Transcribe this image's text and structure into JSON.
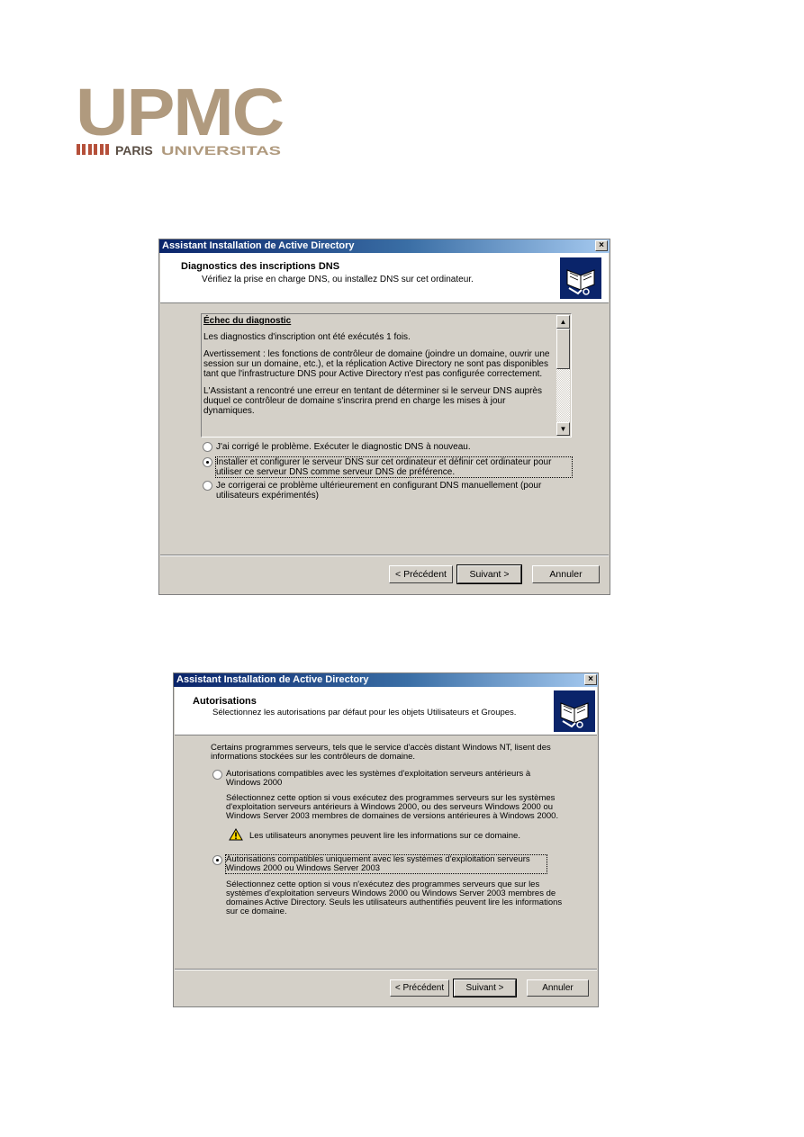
{
  "logo": {
    "text": "UPMC",
    "tagline_1": "PARIS",
    "tagline_2": "UNIVERSITAS"
  },
  "dialog1": {
    "title": "Assistant Installation de Active Directory",
    "close": "×",
    "header_title": "Diagnostics des inscriptions DNS",
    "header_subtitle": "Vérifiez la prise en charge DNS, ou installez DNS sur cet ordinateur.",
    "header_icon": "directory-book-icon",
    "diagnostic": {
      "heading": "Échec du diagnostic",
      "p1": "Les diagnostics d'inscription ont été exécutés 1 fois.",
      "p2": "Avertissement : les fonctions de contrôleur de domaine (joindre un domaine, ouvrir une session sur un domaine, etc.), et la réplication Active Directory ne sont pas disponibles tant que l'infrastructure DNS pour Active Directory n'est pas configurée correctement.",
      "p3": "L'Assistant a rencontré une erreur en tentant de déterminer si le serveur DNS auprès duquel ce contrôleur de domaine s'inscrira prend en charge les mises à jour dynamiques."
    },
    "options": [
      {
        "label": "J'ai corrigé le problème. Exécuter le diagnostic DNS à nouveau.",
        "selected": false
      },
      {
        "label": "Installer et configurer le serveur DNS sur cet ordinateur et définir cet ordinateur pour utiliser ce serveur DNS comme serveur DNS de préférence.",
        "selected": true
      },
      {
        "label": "Je corrigerai ce problème ultérieurement en configurant DNS manuellement (pour utilisateurs expérimentés)",
        "selected": false
      }
    ],
    "buttons": {
      "back": "< Précédent",
      "next": "Suivant >",
      "cancel": "Annuler"
    }
  },
  "dialog2": {
    "title": "Assistant Installation de Active Directory",
    "close": "×",
    "header_title": "Autorisations",
    "header_subtitle": "Sélectionnez les autorisations par défaut pour les objets Utilisateurs et Groupes.",
    "header_icon": "directory-book-icon",
    "intro": "Certains programmes serveurs, tels que le service d'accès distant Windows NT, lisent des informations stockées sur les contrôleurs de domaine.",
    "option1_label": "Autorisations compatibles avec les systèmes d'exploitation serveurs antérieurs à Windows 2000",
    "option1_desc": "Sélectionnez cette option si vous exécutez des programmes serveurs sur les systèmes d'exploitation serveurs antérieurs à Windows 2000, ou des serveurs Windows 2000 ou Windows Server 2003 membres de domaines de versions antérieures à Windows 2000.",
    "warning_icon": "warning-icon",
    "warning_text": "Les utilisateurs anonymes peuvent lire les informations sur ce domaine.",
    "option2_label": "Autorisations compatibles uniquement avec les systèmes d'exploitation serveurs Windows 2000 ou Windows Server 2003",
    "option2_desc": "Sélectionnez cette option si vous n'exécutez des programmes serveurs que sur les systèmes d'exploitation serveurs Windows 2000 ou Windows Server 2003 membres de domaines Active Directory. Seuls les utilisateurs authentifiés peuvent lire les informations sur ce domaine.",
    "option1_selected": false,
    "option2_selected": true,
    "buttons": {
      "back": "< Précédent",
      "next": "Suivant >",
      "cancel": "Annuler"
    }
  }
}
